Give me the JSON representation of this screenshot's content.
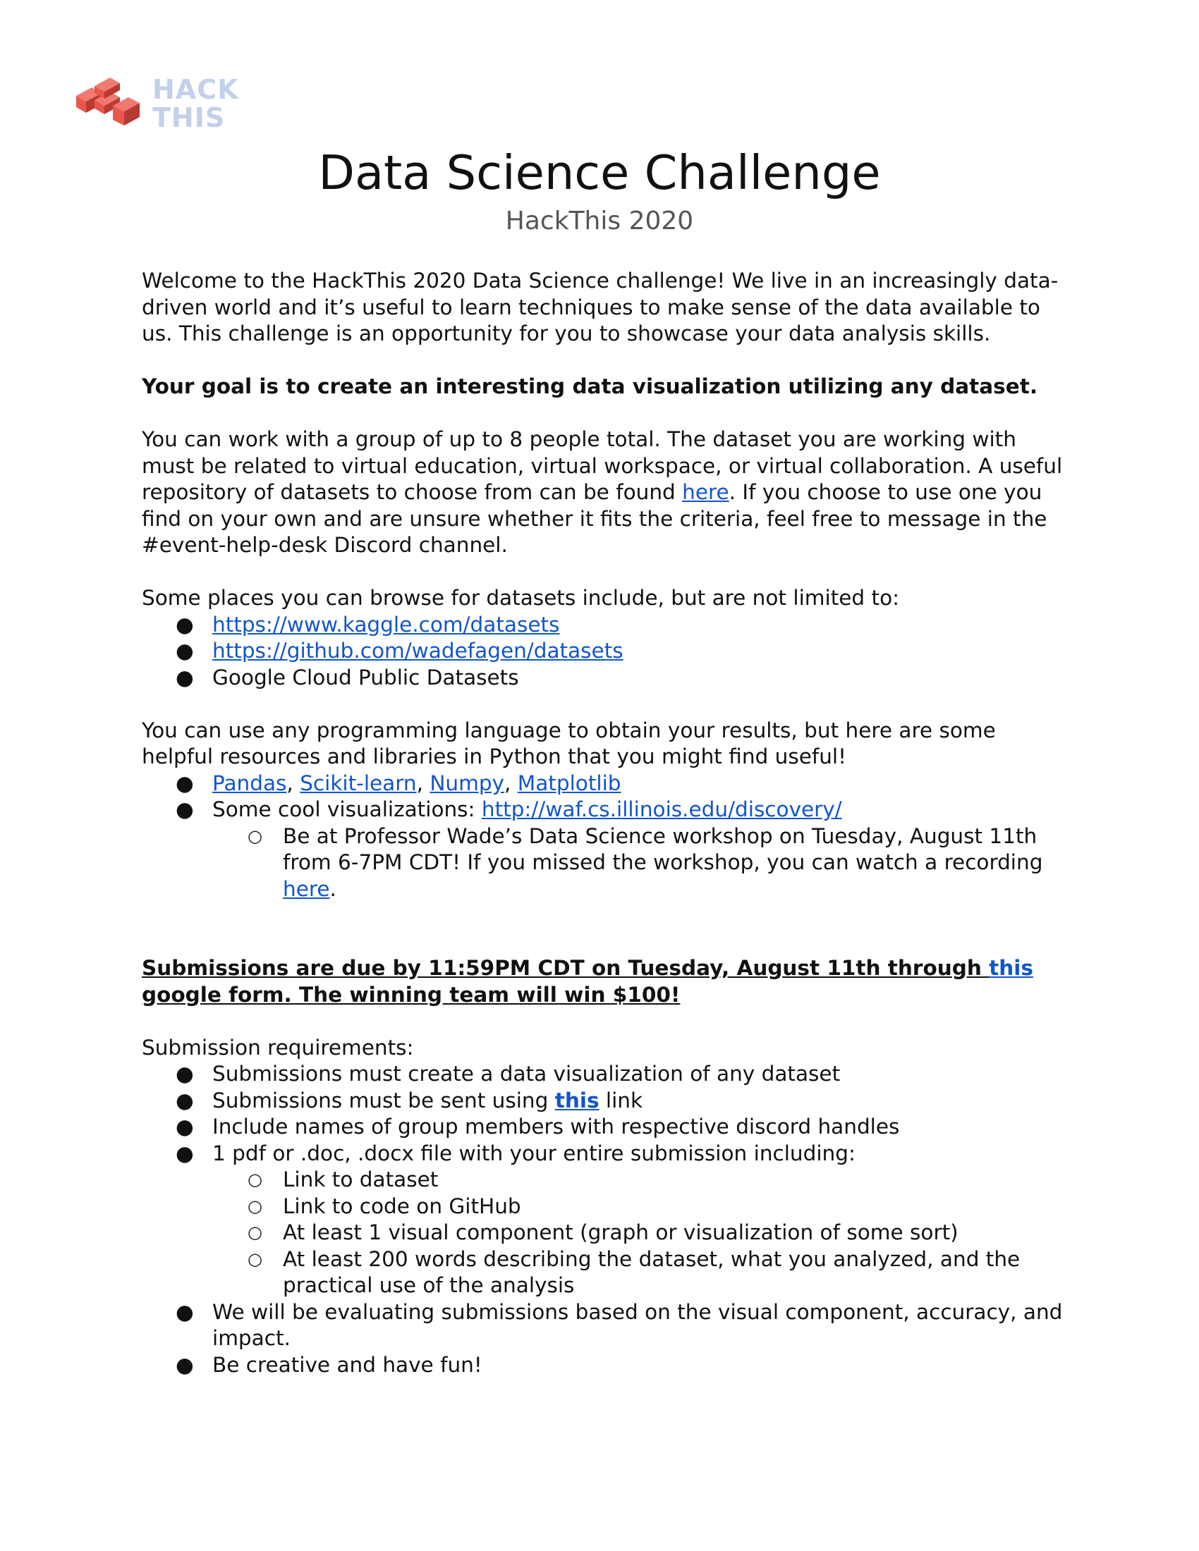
{
  "logo": {
    "line1": "HACK",
    "line2": "THIS",
    "colors": {
      "mark": "#e8574c",
      "mark_dark": "#b83a33",
      "text": "#c3d0ea"
    }
  },
  "title": "Data Science Challenge",
  "subtitle": "HackThis 2020",
  "intro": "Welcome to the HackThis 2020 Data Science challenge! We live in an increasingly data-driven world and it’s useful to learn techniques to make sense of the data available to us. This challenge is an opportunity for you to showcase your data analysis skills.",
  "goal": "Your goal is to create an interesting data visualization utilizing any dataset.",
  "group_para": {
    "before_link": "You can work with a group of up to 8 people total. The dataset you are working with must be related to virtual education, virtual workspace, or virtual collaboration. A useful repository of datasets to choose from can be found ",
    "link": "here",
    "after_link": ". If you choose to use one you find on your own and are unsure whether it fits the criteria, feel free to message in the #event-help-desk Discord channel."
  },
  "browse": {
    "intro": "Some places you can browse for datasets include, but are not limited to:",
    "items": [
      "https://www.kaggle.com/datasets",
      "https://github.com/wadefagen/datasets",
      "Google Cloud Public Datasets"
    ]
  },
  "resources": {
    "intro": "You can use any programming language to obtain your results, but here are some helpful resources and libraries in Python that you might find useful!",
    "libs": [
      "Pandas",
      "Scikit-learn",
      "Numpy",
      "Matplotlib"
    ],
    "viz_label": "Some cool visualizations: ",
    "viz_link": "http://waf.cs.illinois.edu/discovery/",
    "workshop_before": "Be at Professor Wade’s Data Science workshop on Tuesday, August 11th from 6-7PM CDT! If you missed the workshop, you can watch a recording ",
    "workshop_link": "here",
    "workshop_after": "."
  },
  "due": {
    "before_link": "Submissions are due by 11:59PM CDT on Tuesday, August 11th through ",
    "link": "this",
    "after_link": " google form. The winning team will win $100!"
  },
  "requirements": {
    "intro": "Submission requirements:",
    "item1": "Submissions must create a data visualization of any dataset",
    "item2_before": "Submissions must be sent using ",
    "item2_link": "this",
    "item2_after": " link",
    "item3": "Include names of group members with respective discord handles",
    "item4": "1 pdf or .doc, .docx file with your entire submission including:",
    "sub_items": [
      "Link to dataset",
      "Link to code on GitHub",
      "At least 1 visual component (graph or visualization of some sort)",
      "At least 200 words describing the dataset, what you analyzed, and the practical use of the analysis"
    ],
    "item5": "We will be evaluating submissions based on the visual component, accuracy, and impact.",
    "item6": "Be creative and have fun!"
  },
  "bullets": {
    "filled": "●",
    "hollow": "○"
  }
}
